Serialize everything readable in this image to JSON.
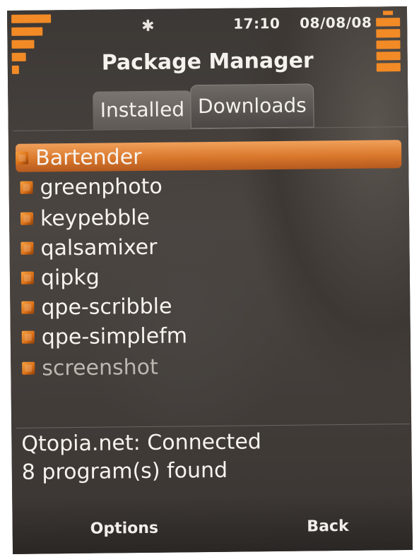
{
  "status_bar": {
    "bluetooth_icon": "bluetooth-icon",
    "time": "17:10",
    "date": "08/08/08",
    "signal_icon": "signal-strength-icon",
    "battery_icon": "battery-icon",
    "accent_color": "#f28a26"
  },
  "app": {
    "title": "Package Manager"
  },
  "tabs": [
    {
      "label": "Installed",
      "active": false
    },
    {
      "label": "Downloads",
      "active": true
    }
  ],
  "packages": {
    "icon": "package-icon",
    "items": [
      {
        "label": "Bartender",
        "selected": true
      },
      {
        "label": "greenphoto",
        "selected": false
      },
      {
        "label": "keypebble",
        "selected": false
      },
      {
        "label": "qalsamixer",
        "selected": false
      },
      {
        "label": "qipkg",
        "selected": false
      },
      {
        "label": "qpe-scribble",
        "selected": false
      },
      {
        "label": "qpe-simplefm",
        "selected": false
      },
      {
        "label": "screenshot",
        "selected": false,
        "dimmed": true
      }
    ]
  },
  "status_messages": {
    "connection": "Qtopia.net: Connected",
    "count": "8 program(s) found"
  },
  "softkeys": {
    "left": "Options",
    "right": "Back"
  }
}
